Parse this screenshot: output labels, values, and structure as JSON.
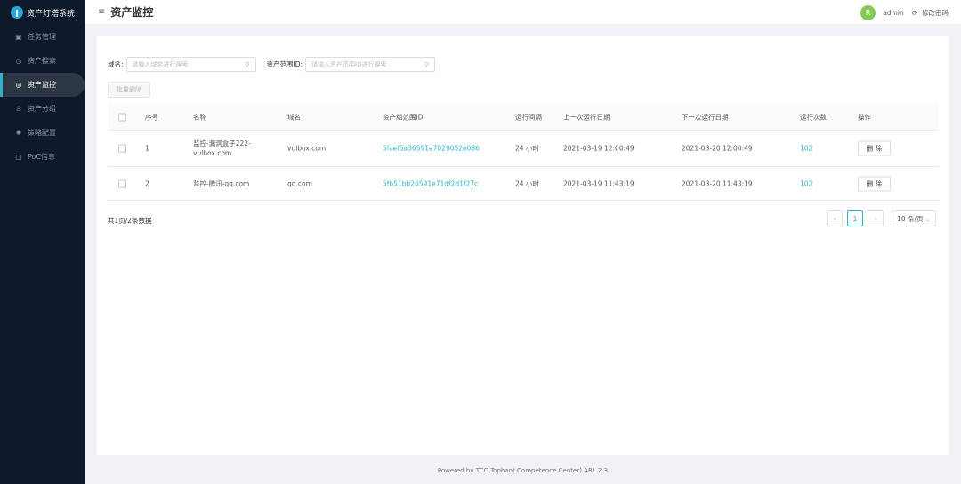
{
  "app": {
    "title": "资产灯塔系统"
  },
  "sidebar": {
    "items": [
      {
        "label": "任务管理",
        "icon": "calendar-icon"
      },
      {
        "label": "资产搜索",
        "icon": "search-icon"
      },
      {
        "label": "资产监控",
        "icon": "monitor-icon",
        "active": true
      },
      {
        "label": "资产分组",
        "icon": "sitemap-icon"
      },
      {
        "label": "策略配置",
        "icon": "gear-icon"
      },
      {
        "label": "PoC信息",
        "icon": "terminal-icon"
      }
    ]
  },
  "header": {
    "title": "资产监控",
    "user": "admin",
    "change_password": "修改密码",
    "avatar_letter": "R"
  },
  "filters": {
    "domain_label": "域名:",
    "domain_placeholder": "请输入域名进行搜索",
    "scope_label": "资产范围ID:",
    "scope_placeholder": "请输入资产范围ID进行搜索"
  },
  "batch_delete": "批量删除",
  "table": {
    "headers": [
      "序号",
      "名称",
      "域名",
      "资产组范围ID",
      "运行间隔",
      "上一次运行日期",
      "下一次运行日期",
      "运行次数",
      "操作"
    ],
    "rows": [
      {
        "no": "1",
        "name": "监控-漏洞盒子222-vulbox.com",
        "domain": "vulbox.com",
        "scope_id": "5fcef5a36591e7029052e086",
        "interval": "24 小时",
        "last": "2021-03-19 12:00:49",
        "next": "2021-03-20 12:00:49",
        "count": "102",
        "action": "删 除"
      },
      {
        "no": "2",
        "name": "监控-腾讯-qq.com",
        "domain": "qq.com",
        "scope_id": "5fb51bb26591e71df2d1f27c",
        "interval": "24 小时",
        "last": "2021-03-19 11:43:19",
        "next": "2021-03-20 11:43:19",
        "count": "102",
        "action": "删 除"
      }
    ]
  },
  "pagination": {
    "total": "共1页/2条数据",
    "current": "1",
    "prev": "‹",
    "next": "›",
    "page_size": "10 条/页"
  },
  "footer": "Powered by TCC(Tophant Competence Center) ARL 2.3",
  "colors": {
    "accent": "#2bb3c9",
    "sidebar": "#0e1a2b",
    "avatar": "#85c956"
  }
}
